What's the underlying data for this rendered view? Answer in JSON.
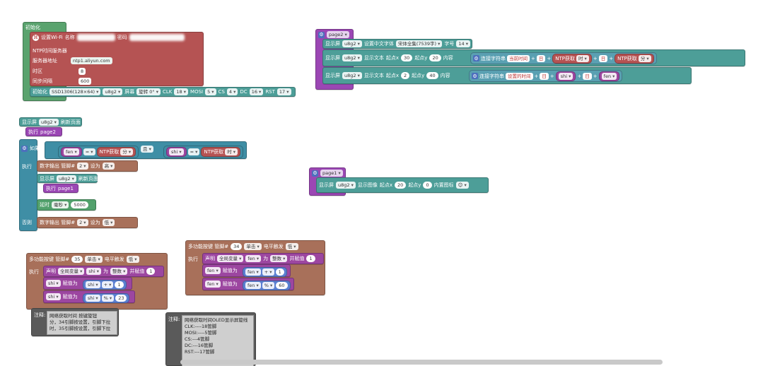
{
  "colors": {
    "network": "#b55353",
    "display": "#4d9e98",
    "procedure": "#9b47b4",
    "control": "#3f8ea5",
    "io": "#a8705a",
    "variable": "#9c46a0",
    "timer": "#52a16c",
    "text": "#5aa0b2",
    "comment": "#5a5a5a"
  },
  "init": {
    "header": "初始化",
    "wifi_label": "设置Wi-Fi",
    "name_label": "名称",
    "name_value": "xxxxxxxx",
    "pwd_label": "密码",
    "pwd_value": "xxxxxxxx",
    "ntp_label": "NTP时间服务器",
    "server_label": "服务器地址",
    "server_value": "ntp1.aliyun.com",
    "tz_label": "时区",
    "tz_value": "8",
    "sync_label": "同步间隔",
    "sync_value": "600",
    "oled": {
      "init": "初始化",
      "model": "SSD1306(128×64)",
      "name": "u8g2",
      "screen_label": "屏幕",
      "rotate": "旋转 0°",
      "clk_label": "CLK",
      "clk": "18",
      "mosi_label": "MOSI",
      "mosi": "5",
      "cs_label": "CS",
      "cs": "4",
      "dc_label": "DC",
      "dc": "16",
      "rst_label": "RST",
      "rst": "17"
    }
  },
  "page2": {
    "name": "page2",
    "font_label1": "显示屏",
    "screen": "u8g2",
    "font_label2": "设置中文字体",
    "font": "宋体全集(7539字)",
    "size_label": "字号",
    "size": "14",
    "line1": {
      "a": "显示屏",
      "b": "显示文本",
      "x_label": "起点x",
      "x": "30",
      "y_label": "起点y",
      "y": "20",
      "content": "内容",
      "join": "连接字符串",
      "s1": "当前时间",
      "s2": "日",
      "ntp1_label": "NTP获取",
      "ntp1_val": "时",
      "s3": "日",
      "ntp2_label": "NTP获取",
      "ntp2_val": "分"
    },
    "line2": {
      "a": "显示屏",
      "b": "显示文本",
      "x_label": "起点x",
      "x": "2",
      "y_label": "起点y",
      "y": "40",
      "content": "内容",
      "join": "连接字符串",
      "s1": "设置的时间",
      "s2": "日",
      "v1": "shi",
      "s3": "日",
      "v2": "fen"
    }
  },
  "loop": {
    "refresh_a": "显示屏",
    "screen": "u8g2",
    "refresh_b": "刷新页面",
    "exec_label": "执行",
    "exec_page": "page2",
    "if_label": "如果",
    "do_label": "执行",
    "else_label": "否则",
    "var_fen": "fen",
    "eq": "=",
    "ntp_label": "NTP获取",
    "ntp_fen": "分",
    "and": "且",
    "var_shi": "shi",
    "ntp_shi": "时",
    "dout1": {
      "label": "数字输出 管脚#",
      "pin": "2",
      "set": "设为",
      "val": "高"
    },
    "refresh2_a": "显示屏",
    "refresh2_b": "刷新页面",
    "exec2_label": "执行",
    "exec2_page": "page1",
    "delay": {
      "label": "延时",
      "unit": "毫秒",
      "ms": "5000"
    },
    "dout2": {
      "label": "数字输出 管脚#",
      "pin": "2",
      "set": "设为",
      "val": "低"
    }
  },
  "page1": {
    "name": "page1",
    "a": "显示屏",
    "screen": "u8g2",
    "b": "显示图像",
    "x_label": "起点x",
    "x": "20",
    "y_label": "起点y",
    "y": "0",
    "icon_label": "内置图标",
    "icon": "😊"
  },
  "btn35": {
    "label": "多功能按键 管脚#",
    "pin": "35",
    "mode": "单击",
    "trig": "电平触发",
    "level": "低",
    "exec": "执行",
    "declare": "声明",
    "scope": "全局变量",
    "var": "shi",
    "as": "为",
    "type": "整数",
    "init": "并赋值",
    "init_val": "1",
    "as1": {
      "var": "shi",
      "assign": "赋值为",
      "lhs": "shi",
      "op": "+",
      "rhs": "1"
    },
    "as2": {
      "var": "shi",
      "assign": "赋值为",
      "lhs": "shi",
      "op": "%",
      "rhs": "23"
    }
  },
  "btn34": {
    "label": "多功能按键 管脚#",
    "pin": "34",
    "mode": "单击",
    "trig": "电平触发",
    "level": "低",
    "exec": "执行",
    "declare": "声明",
    "scope": "全局变量",
    "var": "fen",
    "as": "为",
    "type": "整数",
    "init": "并赋值",
    "init_val": "1",
    "as1": {
      "var": "fen",
      "assign": "赋值为",
      "lhs": "fen",
      "op": "+",
      "rhs": "1"
    },
    "as2": {
      "var": "fen",
      "assign": "赋值为",
      "lhs": "fen",
      "op": "%",
      "rhs": "60"
    }
  },
  "note1": {
    "label": "注释:",
    "text": "网络获取时间 按键旋钮\n分，34引脚按设置，引脚下拉\n时，35引脚按设置，引脚下拉"
  },
  "note2": {
    "label": "注释:",
    "text": "网络获取时间OLED显示屏旋线\nCLK:----18管脚\nMOSI:----5管脚\nCS:---4管脚\nDC:---16管脚\nRST:---17管脚"
  }
}
